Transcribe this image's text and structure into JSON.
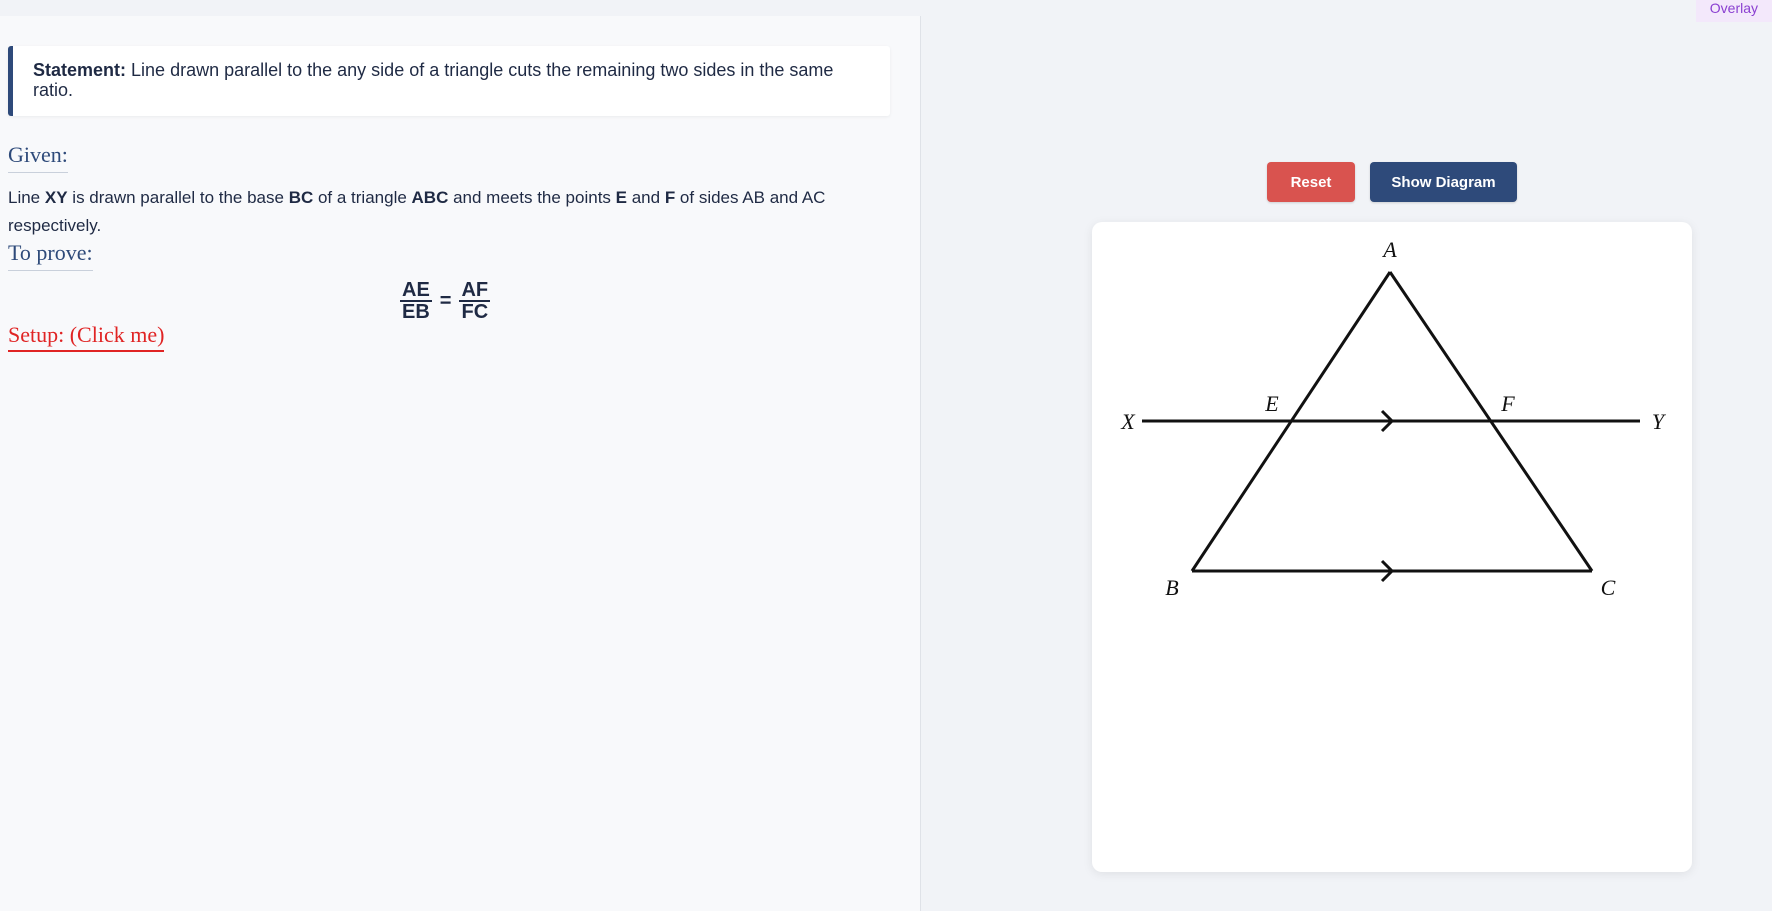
{
  "overlay": {
    "label": "Overlay"
  },
  "statement": {
    "label": "Statement:",
    "text": "Line drawn parallel to the any side of a triangle cuts the remaining two sides in the same ratio."
  },
  "given": {
    "heading": "Given:",
    "parts": [
      "Line ",
      "XY",
      " is drawn parallel to the base ",
      "BC",
      " of a triangle ",
      "ABC",
      " and meets the points ",
      "E",
      " and ",
      "F",
      " of sides AB and AC respectively."
    ]
  },
  "to_prove": {
    "heading": "To prove:",
    "lhs_num": "AE",
    "lhs_den": "EB",
    "equals": "=",
    "rhs_num": "AF",
    "rhs_den": "FC"
  },
  "setup": {
    "label": "Setup: (Click me)"
  },
  "buttons": {
    "reset": "Reset",
    "show_diagram": "Show Diagram"
  },
  "diagram": {
    "labels": {
      "A": "A",
      "B": "B",
      "C": "C",
      "E": "E",
      "F": "F",
      "X": "X",
      "Y": "Y"
    },
    "colors": {
      "line": "#111111"
    }
  }
}
